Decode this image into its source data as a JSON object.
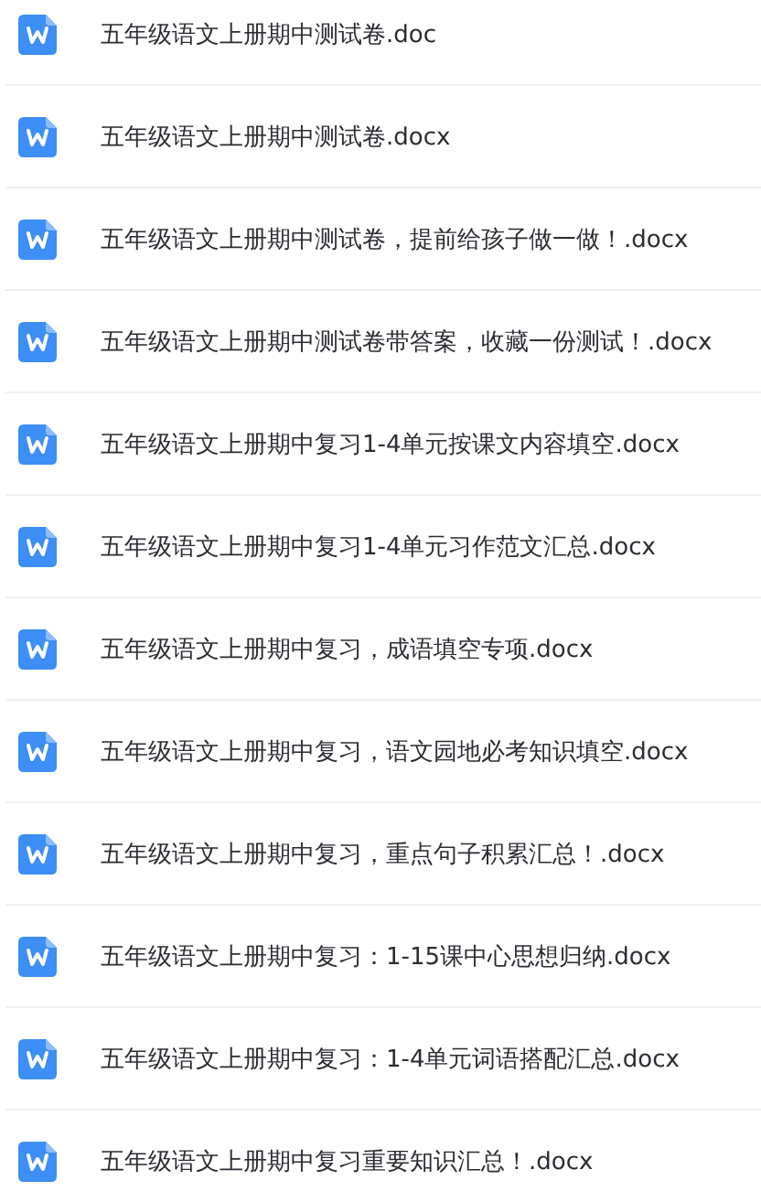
{
  "files": [
    {
      "name": "五年级语文上册期中测试卷.doc"
    },
    {
      "name": "五年级语文上册期中测试卷.docx"
    },
    {
      "name": "五年级语文上册期中测试卷，提前给孩子做一做！.docx"
    },
    {
      "name": "五年级语文上册期中测试卷带答案，收藏一份测试！.docx"
    },
    {
      "name": "五年级语文上册期中复习1-4单元按课文内容填空.docx"
    },
    {
      "name": "五年级语文上册期中复习1-4单元习作范文汇总.docx"
    },
    {
      "name": "五年级语文上册期中复习，成语填空专项.docx"
    },
    {
      "name": "五年级语文上册期中复习，语文园地必考知识填空.docx"
    },
    {
      "name": "五年级语文上册期中复习，重点句子积累汇总！.docx"
    },
    {
      "name": "五年级语文上册期中复习：1-15课中心思想归纳.docx"
    },
    {
      "name": "五年级语文上册期中复习：1-4单元词语搭配汇总.docx"
    },
    {
      "name": "五年级语文上册期中复习重要知识汇总！.docx"
    }
  ]
}
